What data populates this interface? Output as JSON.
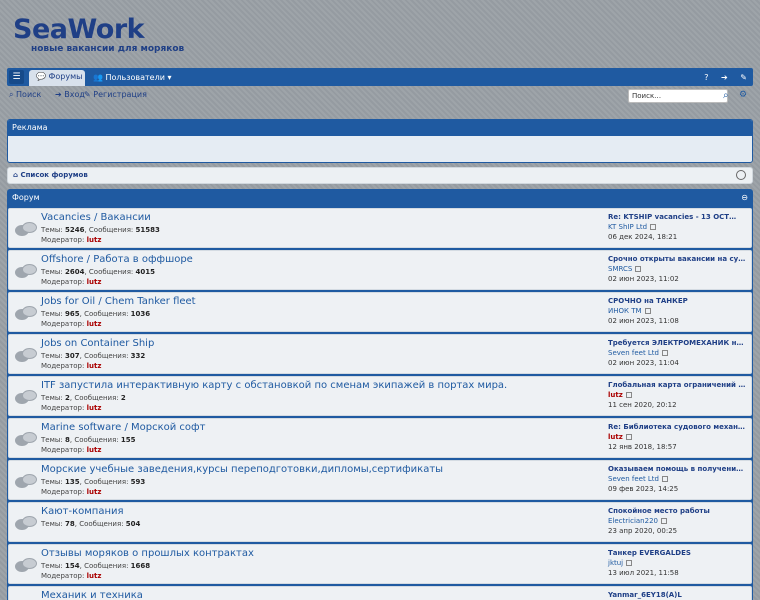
{
  "logo": {
    "main_sea": "Sea",
    "main_work": "Work",
    "subtitle": "новые вакансии для моряков"
  },
  "navbar": {
    "menu_icon": "hamburger-icon",
    "forums_tab": "Форумы",
    "users_menu": "Пользователи",
    "help_icon": "help-icon",
    "login_icon": "login-icon",
    "register_icon": "register-icon"
  },
  "subnav": {
    "search": "Поиск",
    "login": "Вход",
    "register": "Регистрация",
    "search_placeholder": "Поиск…"
  },
  "ad": {
    "title": "Реклама"
  },
  "breadcrumb": {
    "home": "Список форумов"
  },
  "forum_section": {
    "title": "Форум"
  },
  "labels": {
    "topics": "Темы:",
    "posts": "Сообщения:",
    "moderator": "Модератор:"
  },
  "colors": {
    "accent": "#1f5aa1",
    "logo": "#1f3f86",
    "moderator": "#aa0000"
  },
  "forums": [
    {
      "title": "Vacancies / Вакансии",
      "topics": "5246",
      "posts": "51583",
      "moderator": "lutz",
      "last_title": "Re: KTSHIP vacancies - 13 OCT…",
      "last_author": "KT ShIP Ltd",
      "last_date": "06 дек 2024, 18:21",
      "last_author_is_mod": false
    },
    {
      "title": "Offshore / Работа в оффшоре",
      "topics": "2604",
      "posts": "4015",
      "moderator": "lutz",
      "last_title": "Срочно открыты вакансии на су…",
      "last_author": "SMRCS",
      "last_date": "02 июн 2023, 11:02",
      "last_author_is_mod": false
    },
    {
      "title": "Jobs for Oil / Chem Tanker fleet",
      "topics": "965",
      "posts": "1036",
      "moderator": "lutz",
      "last_title": "СРОЧНО на ТАНКЕР",
      "last_author": "ИНОК ТМ",
      "last_date": "02 июн 2023, 11:08",
      "last_author_is_mod": false
    },
    {
      "title": "Jobs on Container Ship",
      "topics": "307",
      "posts": "332",
      "moderator": "lutz",
      "last_title": "Требуется ЭЛЕКТРОМЕХАНИК на к…",
      "last_author": "Seven feet Ltd",
      "last_date": "02 июн 2023, 11:04",
      "last_author_is_mod": false
    },
    {
      "title": "ITF запустила интерактивную карту с обстановкой по сменам экипажей в портах мира.",
      "topics": "2",
      "posts": "2",
      "moderator": "lutz",
      "last_title": "Глобальная карта ограничений …",
      "last_author": "lutz",
      "last_date": "11 сен 2020, 20:12",
      "last_author_is_mod": true
    },
    {
      "title": "Marine software / Морской софт",
      "topics": "8",
      "posts": "155",
      "moderator": "lutz",
      "last_title": "Re: Библиотека судового механ…",
      "last_author": "lutz",
      "last_date": "12 янв 2018, 18:57",
      "last_author_is_mod": true
    },
    {
      "title": "Морские учебные заведения,курсы переподготовки,дипломы,сертификаты",
      "topics": "135",
      "posts": "593",
      "moderator": "lutz",
      "last_title": "Оказываем помощь в получении …",
      "last_author": "Seven feet Ltd",
      "last_date": "09 фев 2023, 14:25",
      "last_author_is_mod": false
    },
    {
      "title": "Кают-компания",
      "topics": "78",
      "posts": "504",
      "moderator": "",
      "last_title": "Спокойное место работы",
      "last_author": "Electrician220",
      "last_date": "23 апр 2020, 00:25",
      "last_author_is_mod": false
    },
    {
      "title": "Отзывы моряков о прошлых контрактах",
      "topics": "154",
      "posts": "1668",
      "moderator": "lutz",
      "last_title": "Танкер EVERGALDES",
      "last_author": "jktuj",
      "last_date": "13 июл 2021, 11:58",
      "last_author_is_mod": false
    },
    {
      "title": "Механик и техника",
      "topics": "",
      "posts": "",
      "moderator": "",
      "last_title": "Yanmar_6EY18(A)L",
      "last_author": "",
      "last_date": "",
      "last_author_is_mod": false
    }
  ]
}
